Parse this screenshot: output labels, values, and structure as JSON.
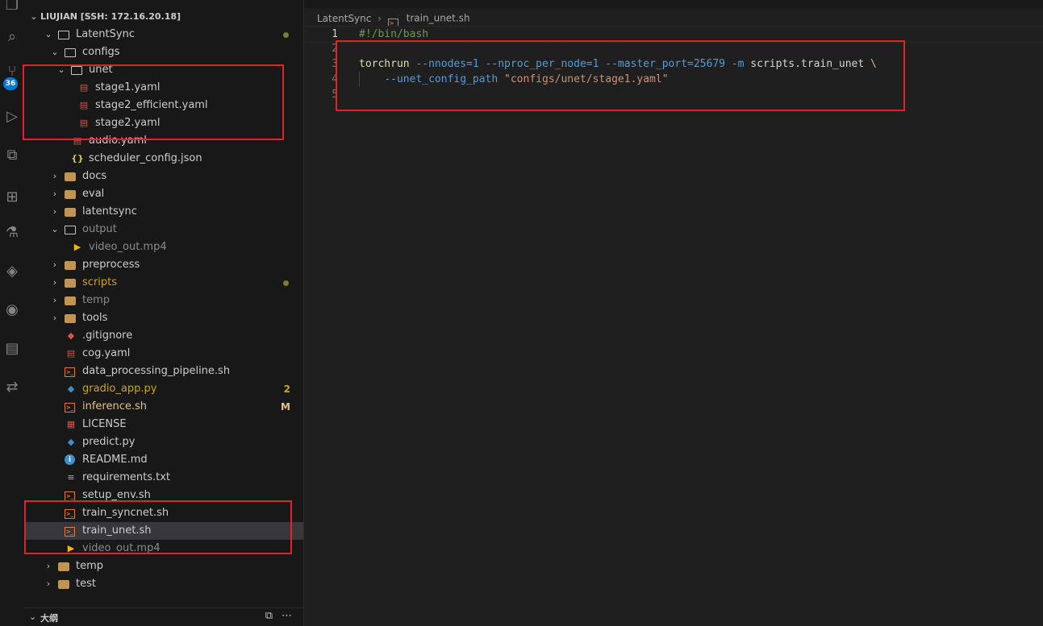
{
  "explorer": {
    "root_title": "LIUJIAN [SSH: 172.16.20.18]",
    "items": [
      {
        "label": "LatentSync",
        "indent": 1,
        "kind": "folder",
        "open": true,
        "dot": true
      },
      {
        "label": "configs",
        "indent": 2,
        "kind": "folder",
        "open": true
      },
      {
        "label": "unet",
        "indent": 3,
        "kind": "folder",
        "open": true
      },
      {
        "label": "stage1.yaml",
        "indent": 4,
        "kind": "yaml"
      },
      {
        "label": "stage2_efficient.yaml",
        "indent": 4,
        "kind": "yaml"
      },
      {
        "label": "stage2.yaml",
        "indent": 4,
        "kind": "yaml"
      },
      {
        "label": "audio.yaml",
        "indent": 3,
        "kind": "yaml"
      },
      {
        "label": "scheduler_config.json",
        "indent": 3,
        "kind": "json"
      },
      {
        "label": "docs",
        "indent": 2,
        "kind": "folder",
        "open": false
      },
      {
        "label": "eval",
        "indent": 2,
        "kind": "folder",
        "open": false
      },
      {
        "label": "latentsync",
        "indent": 2,
        "kind": "folder",
        "open": false
      },
      {
        "label": "output",
        "indent": 2,
        "kind": "folder",
        "open": true,
        "dim": true
      },
      {
        "label": "video_out.mp4",
        "indent": 3,
        "kind": "video",
        "dim": true
      },
      {
        "label": "preprocess",
        "indent": 2,
        "kind": "folder",
        "open": false
      },
      {
        "label": "scripts",
        "indent": 2,
        "kind": "folder",
        "open": false,
        "color": "#cca700",
        "dot": true
      },
      {
        "label": "temp",
        "indent": 2,
        "kind": "folder",
        "open": false,
        "dim": true
      },
      {
        "label": "tools",
        "indent": 2,
        "kind": "folder",
        "open": false
      },
      {
        "label": ".gitignore",
        "indent": 2,
        "kind": "git"
      },
      {
        "label": "cog.yaml",
        "indent": 2,
        "kind": "yaml"
      },
      {
        "label": "data_processing_pipeline.sh",
        "indent": 2,
        "kind": "sh"
      },
      {
        "label": "gradio_app.py",
        "indent": 2,
        "kind": "py",
        "color": "#cca700",
        "deco": "2"
      },
      {
        "label": "inference.sh",
        "indent": 2,
        "kind": "sh",
        "color": "#e2c08d",
        "deco": "M"
      },
      {
        "label": "LICENSE",
        "indent": 2,
        "kind": "lic"
      },
      {
        "label": "predict.py",
        "indent": 2,
        "kind": "py"
      },
      {
        "label": "README.md",
        "indent": 2,
        "kind": "info"
      },
      {
        "label": "requirements.txt",
        "indent": 2,
        "kind": "txt"
      },
      {
        "label": "setup_env.sh",
        "indent": 2,
        "kind": "sh"
      },
      {
        "label": "train_syncnet.sh",
        "indent": 2,
        "kind": "sh"
      },
      {
        "label": "train_unet.sh",
        "indent": 2,
        "kind": "sh",
        "active": true
      },
      {
        "label": "video_out.mp4",
        "indent": 2,
        "kind": "video",
        "dim": true
      },
      {
        "label": "temp",
        "indent": 1,
        "kind": "folder",
        "open": false
      },
      {
        "label": "test",
        "indent": 1,
        "kind": "folder",
        "open": false
      }
    ]
  },
  "outline": {
    "title": "大纲"
  },
  "breadcrumb": {
    "folder": "LatentSync",
    "file": "train_unet.sh"
  },
  "editor": {
    "lines": [
      {
        "n": "1",
        "current": true,
        "tokens": [
          {
            "t": "#!/bin/bash",
            "c": "c-comment"
          }
        ]
      },
      {
        "n": "2",
        "tokens": []
      },
      {
        "n": "3",
        "tokens": [
          {
            "t": "torchrun",
            "c": "c-cmd"
          },
          {
            "t": " ",
            "c": "c-plain"
          },
          {
            "t": "--nnodes=1",
            "c": "c-flag"
          },
          {
            "t": " ",
            "c": "c-plain"
          },
          {
            "t": "--nproc_per_node=1",
            "c": "c-flag"
          },
          {
            "t": " ",
            "c": "c-plain"
          },
          {
            "t": "--master_port=25679",
            "c": "c-flag"
          },
          {
            "t": " ",
            "c": "c-plain"
          },
          {
            "t": "-m",
            "c": "c-flag"
          },
          {
            "t": " scripts.train_unet ",
            "c": "c-plain"
          },
          {
            "t": "\\",
            "c": "c-esc"
          }
        ]
      },
      {
        "n": "4",
        "tokens": [
          {
            "t": "    ",
            "c": "c-plain"
          },
          {
            "t": "--unet_config_path",
            "c": "c-flag"
          },
          {
            "t": " ",
            "c": "c-plain"
          },
          {
            "t": "\"configs/unet/stage1.yaml\"",
            "c": "c-str"
          }
        ]
      },
      {
        "n": "5",
        "tokens": []
      }
    ]
  },
  "activity": {
    "icons": [
      "explorer-icon",
      "search-icon",
      "source-control-icon",
      "run-debug-icon",
      "remote-explorer-icon",
      "extensions-icon",
      "testing-icon",
      "docker-icon",
      "github-icon",
      "containers-icon",
      "share-icon"
    ],
    "scm_badge": "36"
  },
  "colors": {
    "highlight_box": "#e0242c",
    "accent": "#0078d4"
  }
}
